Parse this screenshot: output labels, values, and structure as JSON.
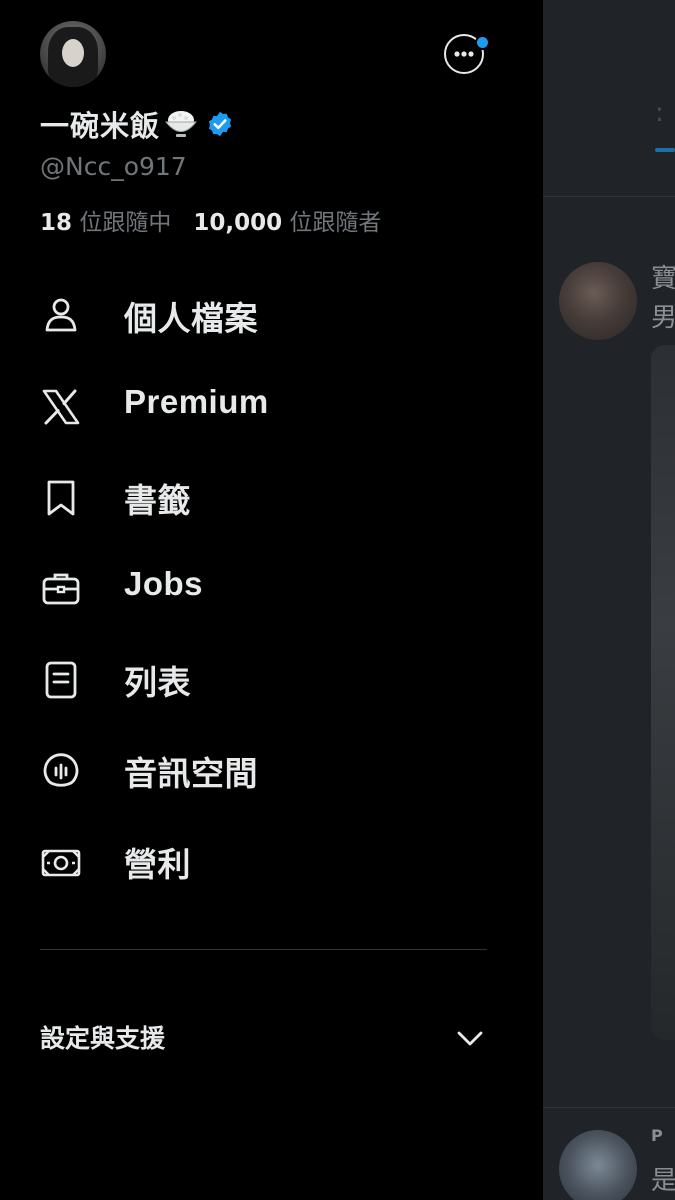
{
  "profile": {
    "display_name": "一碗米飯",
    "handle": "@Ncc_o917",
    "following_count": "18",
    "following_label": "位跟隨中",
    "followers_count": "10,000",
    "followers_label": "位跟隨者",
    "verified": true,
    "verified_color": "#1d9bf0"
  },
  "menu": {
    "items": [
      {
        "label": "個人檔案",
        "icon": "person-icon"
      },
      {
        "label": "Premium",
        "icon": "x-logo-icon"
      },
      {
        "label": "書籤",
        "icon": "bookmark-icon"
      },
      {
        "label": "Jobs",
        "icon": "briefcase-icon"
      },
      {
        "label": "列表",
        "icon": "list-icon"
      },
      {
        "label": "音訊空間",
        "icon": "spaces-mic-icon"
      },
      {
        "label": "營利",
        "icon": "monetization-icon"
      }
    ]
  },
  "settings": {
    "label": "設定與支援",
    "icon": "chevron-down-icon"
  },
  "background": {
    "post1_name_glyph": "寶",
    "post1_text_glyph": "男",
    "post2_name_glyph": "P",
    "post2_text_glyph": "是"
  },
  "colors": {
    "background": "#000000",
    "text": "#e7e9ea",
    "secondary_text": "#71767b",
    "accent": "#1d9bf0"
  }
}
